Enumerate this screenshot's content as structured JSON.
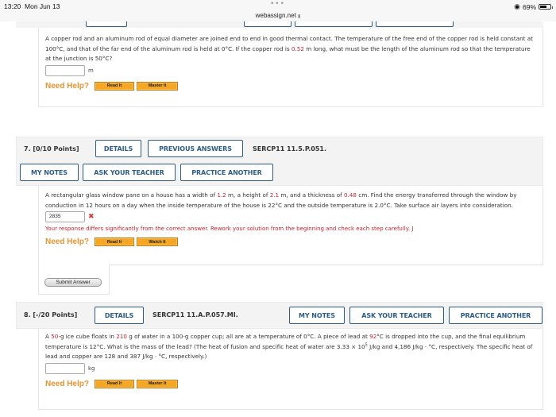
{
  "status_bar": {
    "time": "13:20",
    "date": "Mon Jun 13",
    "url": "webassign.net",
    "lock_icon": "lock-icon",
    "wifi_icon": "wifi-icon",
    "battery_percent": "69%",
    "battery_level": 0.69
  },
  "q6": {
    "text_parts": {
      "p1": "A copper rod and an aluminum rod of equal diameter are joined end to end in good thermal contact. The temperature of the free end of the copper rod is held constant at 100°C, and that of the far end of the aluminum rod is held at 0°C. If the copper rod is ",
      "v1": "0.52",
      "p2": " m long, what must be the length of the aluminum rod so that the temperature at the junction is 50°C?"
    },
    "answer_value": "",
    "unit": "m",
    "need_help": "Need Help?",
    "help_buttons": [
      "Read It",
      "Master It"
    ]
  },
  "q7": {
    "label": "7.  [0/10 Points]",
    "buttons": {
      "details": "DETAILS",
      "previous_answers": "PREVIOUS ANSWERS",
      "my_notes": "MY NOTES",
      "ask_teacher": "ASK YOUR TEACHER",
      "practice_another": "PRACTICE ANOTHER"
    },
    "code": "SERCP11 11.5.P.051.",
    "text_parts": {
      "p1": "A rectangular glass window pane on a house has a width of ",
      "v1": "1.2",
      "p2": " m, a height of ",
      "v2": "2.1",
      "p3": " m, and a thickness of ",
      "v3": "0.48",
      "p4": " cm. Find the energy transferred through the window by conduction in 12 hours on a day when the inside temperature of the house is 22°C and the outside temperature is 2.0°C. Take surface air layers into consideration."
    },
    "answer_value": "2835",
    "status_icon": "incorrect-x-icon",
    "error_message": "Your response differs significantly from the correct answer. Rework your solution from the beginning and check each step carefully. J",
    "need_help": "Need Help?",
    "help_buttons": [
      "Read It",
      "Watch It"
    ],
    "submit_label": "Submit Answer"
  },
  "q8": {
    "label": "8.  [-/20 Points]",
    "buttons": {
      "details": "DETAILS",
      "my_notes": "MY NOTES",
      "ask_teacher": "ASK YOUR TEACHER",
      "practice_another": "PRACTICE ANOTHER"
    },
    "code": "SERCP11 11.A.P.057.MI.",
    "text_parts": {
      "p1": "A ",
      "v1": "50",
      "p2": "-g ice cube floats in ",
      "v2": "210",
      "p3": " g of water in a 100-g copper cup; all are at a temperature of 0°C. A piece of lead at ",
      "v3": "92",
      "p4": "°C is dropped into the cup, and the final equilibrium temperature is 12°C. What is the mass of the lead? (The heat of fusion and specific heat of water are 3.33 × 10",
      "exp": "5",
      "p5": " J/kg and 4,186 J/kg · °C, respectively. The specific heat of lead and copper are 128 and 387 J/kg · °C, respectively.)"
    },
    "answer_value": "",
    "unit": "kg",
    "need_help": "Need Help?",
    "help_buttons": [
      "Read It",
      "Master It"
    ]
  },
  "colors": {
    "accent_blue": "#2d5c80",
    "value_red": "#c0232f",
    "need_help_orange": "#e69332",
    "help_button_orange": "#f5a623"
  }
}
